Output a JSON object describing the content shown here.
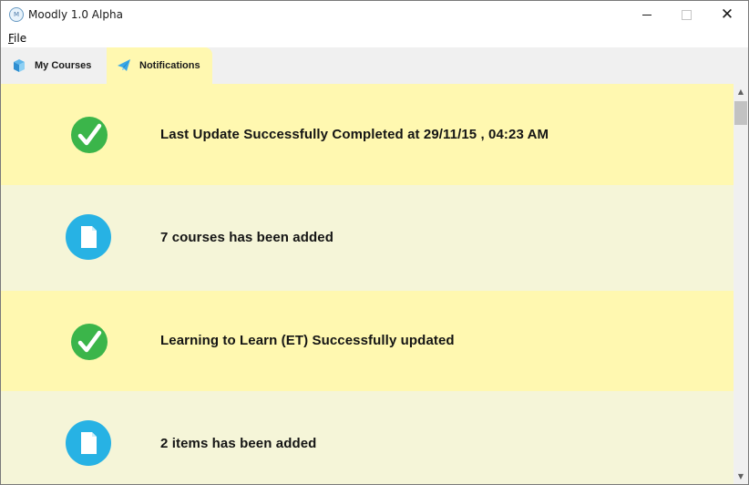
{
  "window": {
    "title": "Moodly 1.0 Alpha",
    "app_icon_glyph": "M",
    "minimize_icon": "minimize-icon",
    "maximize_icon": "maximize-icon",
    "close_glyph": "✕"
  },
  "menu": {
    "file_mnemonic": "F",
    "file_rest": "ile"
  },
  "tabs": [
    {
      "label": "My Courses",
      "icon": "courses-box-icon",
      "active": false
    },
    {
      "label": "Notifications",
      "icon": "notification-plane-icon",
      "active": true
    }
  ],
  "notifications": [
    {
      "type": "success",
      "icon": "check-icon",
      "message": "Last Update Successfully Completed at 29/11/15 , 04:23 AM",
      "bg": "#fff8b0"
    },
    {
      "type": "info",
      "icon": "document-icon",
      "message": "7 courses has been added",
      "bg": "#f5f5d8"
    },
    {
      "type": "success",
      "icon": "check-icon",
      "message": "Learning to Learn (ET) Successfully updated",
      "bg": "#fff8b0"
    },
    {
      "type": "info",
      "icon": "document-icon",
      "message": "2 items has been added",
      "bg": "#f5f5d8"
    }
  ],
  "colors": {
    "success": "#3bb54a",
    "info": "#27b2e4",
    "highlight_row": "#fff8b0",
    "plain_row": "#f5f5d8",
    "tabbar_bg": "#f0f0f0"
  },
  "scrollbar": {
    "up_glyph": "▲",
    "down_glyph": "▼"
  }
}
